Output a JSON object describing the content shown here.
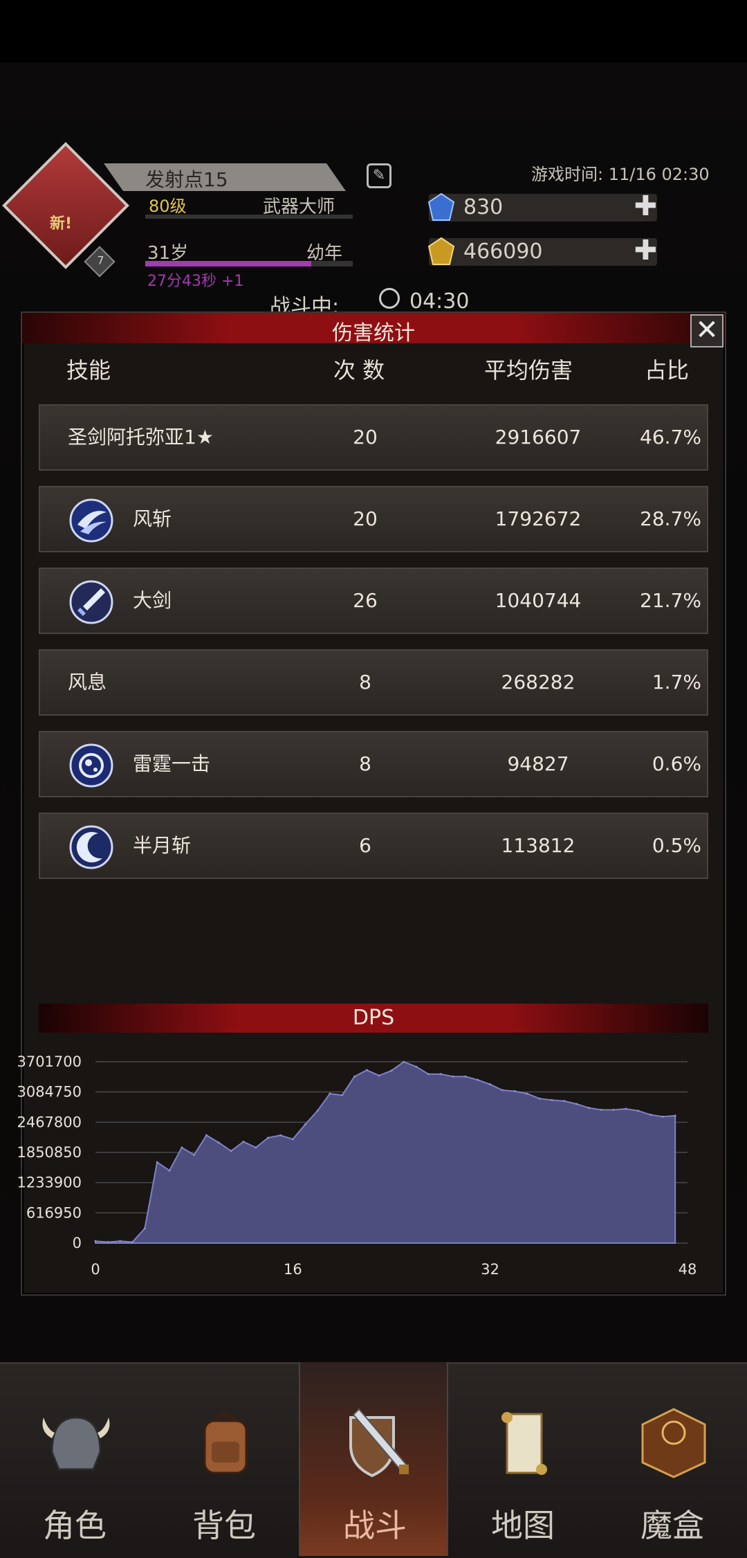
{
  "header": {
    "player_name": "发射点15",
    "level": "80级",
    "class_name": "武器大师",
    "age": "31岁",
    "age_stage": "幼年",
    "age_timer": "27分43秒 +1",
    "emblem_new": "新!",
    "emblem_badge": "7",
    "game_time": "游戏时间: 11/16 02:30",
    "gems": "830",
    "gold": "466090",
    "battle_label": "战斗中:",
    "battle_time": "04:30"
  },
  "panel": {
    "title": "伤害统计",
    "close": "✕",
    "columns": {
      "skill": "技能",
      "count": "次 数",
      "avg": "平均伤害",
      "pct": "占比"
    },
    "rows": [
      {
        "name": "圣剑阿托弥亚1★",
        "icon": "",
        "count": "20",
        "avg": "2916607",
        "pct": "46.7%"
      },
      {
        "name": "风斩",
        "icon": "wind-slash-icon",
        "count": "20",
        "avg": "1792672",
        "pct": "28.7%"
      },
      {
        "name": "大剑",
        "icon": "great-sword-icon",
        "count": "26",
        "avg": "1040744",
        "pct": "21.7%"
      },
      {
        "name": "风息",
        "icon": "",
        "count": "8",
        "avg": "268282",
        "pct": "1.7%"
      },
      {
        "name": "雷霆一击",
        "icon": "thunder-strike-icon",
        "count": "8",
        "avg": "94827",
        "pct": "0.6%"
      },
      {
        "name": "半月斩",
        "icon": "half-moon-slash-icon",
        "count": "6",
        "avg": "113812",
        "pct": "0.5%"
      }
    ]
  },
  "chart_data": {
    "type": "area",
    "title": "DPS",
    "xlabel": "",
    "ylabel": "",
    "x_ticks": [
      "0",
      "16",
      "32",
      "48"
    ],
    "y_ticks": [
      "0",
      "616950",
      "1233900",
      "1850850",
      "2467800",
      "3084750",
      "3701700"
    ],
    "xlim": [
      0,
      48
    ],
    "ylim": [
      0,
      3701700
    ],
    "grid": true,
    "color": "#4e4e7e",
    "series": [
      {
        "x": [
          0,
          1,
          2,
          3,
          4,
          5,
          6,
          7,
          8,
          9,
          10,
          11,
          12,
          13,
          14,
          15,
          16,
          17,
          18,
          19,
          20,
          21,
          22,
          23,
          24,
          25,
          26,
          27,
          28,
          29,
          30,
          31,
          32,
          33,
          34,
          35,
          36,
          37,
          38,
          39,
          40,
          41,
          42,
          43,
          44,
          45,
          46,
          47
        ],
        "values": [
          40000,
          20000,
          40000,
          20000,
          300000,
          1650000,
          1480000,
          1950000,
          1800000,
          2200000,
          2050000,
          1880000,
          2070000,
          1950000,
          2150000,
          2200000,
          2120000,
          2420000,
          2700000,
          3050000,
          3020000,
          3400000,
          3530000,
          3420000,
          3520000,
          3700000,
          3600000,
          3450000,
          3450000,
          3400000,
          3400000,
          3330000,
          3240000,
          3120000,
          3100000,
          3050000,
          2950000,
          2920000,
          2900000,
          2840000,
          2760000,
          2720000,
          2720000,
          2740000,
          2700000,
          2620000,
          2580000,
          2600000
        ]
      }
    ]
  },
  "nav": {
    "items": [
      {
        "label": "角色",
        "icon": "helmet-icon"
      },
      {
        "label": "背包",
        "icon": "backpack-icon"
      },
      {
        "label": "战斗",
        "icon": "shield-sword-icon"
      },
      {
        "label": "地图",
        "icon": "scroll-map-icon"
      },
      {
        "label": "魔盒",
        "icon": "magic-box-icon"
      }
    ],
    "active_index": 2
  },
  "colors": {
    "accent_red": "#8e0f12",
    "area_fill": "#4e4e7e",
    "level_yellow": "#e3c64a",
    "age_purple": "#a23ab0"
  }
}
